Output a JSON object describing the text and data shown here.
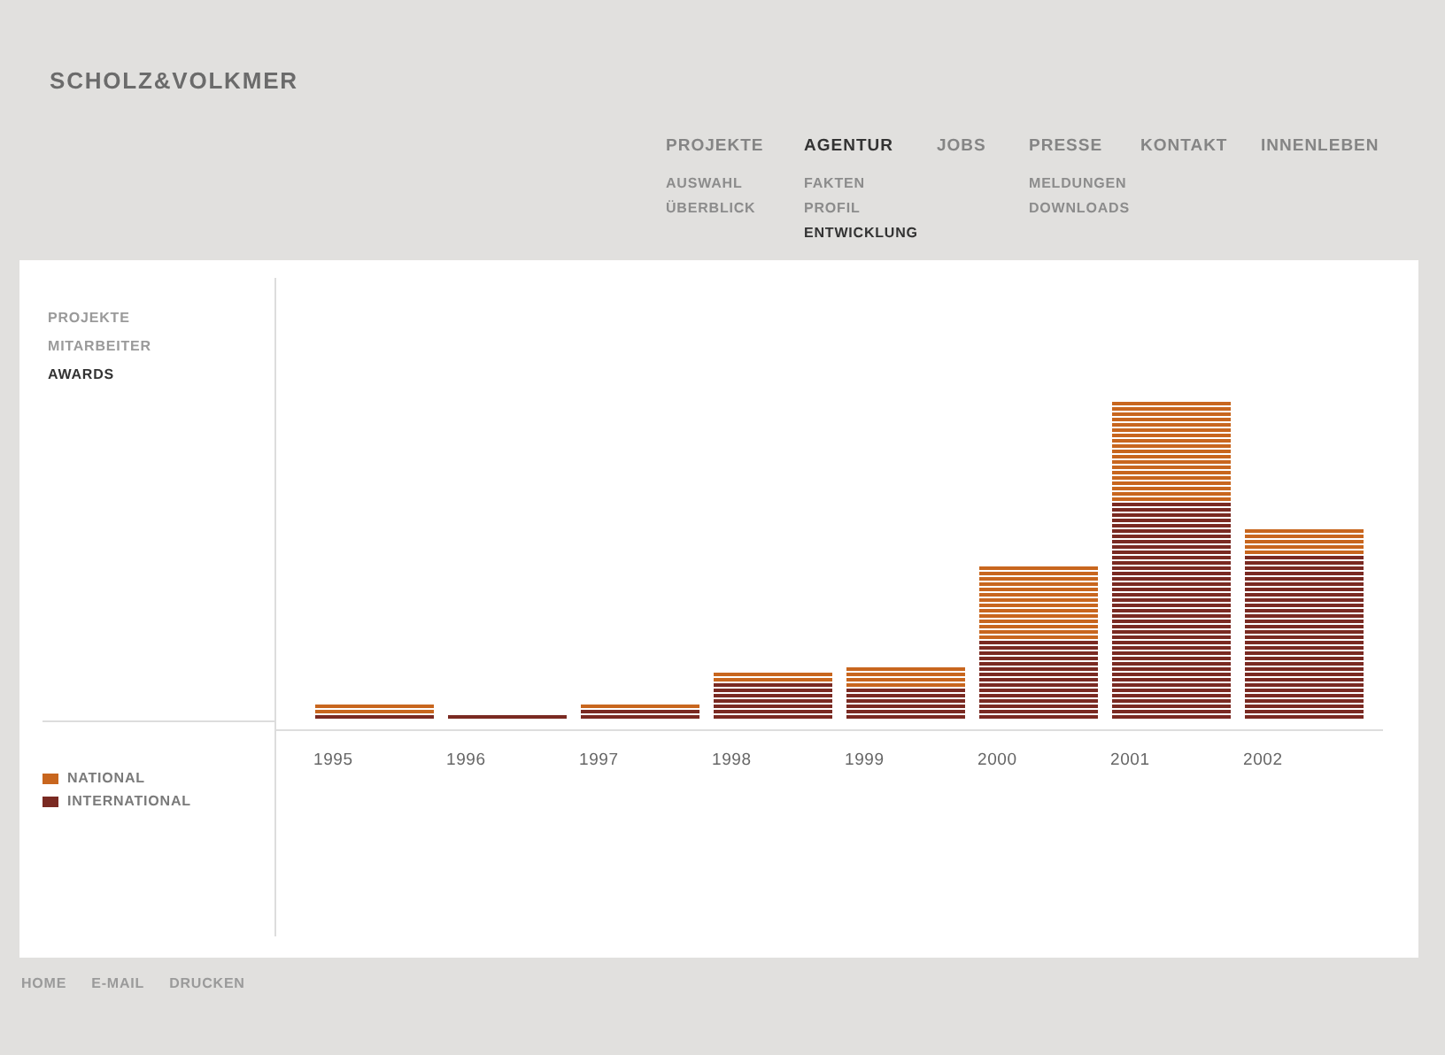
{
  "logo": "SCHOLZ&VOLKMER",
  "nav": [
    {
      "label": "PROJEKTE",
      "selected": false,
      "children": [
        {
          "label": "AUSWAHL",
          "selected": false
        },
        {
          "label": "ÜBERBLICK",
          "selected": false
        }
      ]
    },
    {
      "label": "AGENTUR",
      "selected": true,
      "children": [
        {
          "label": "FAKTEN",
          "selected": false
        },
        {
          "label": "PROFIL",
          "selected": false
        },
        {
          "label": "ENTWICKLUNG",
          "selected": true
        }
      ]
    },
    {
      "label": "JOBS",
      "selected": false
    },
    {
      "label": "PRESSE",
      "selected": false,
      "children": [
        {
          "label": "MELDUNGEN",
          "selected": false
        },
        {
          "label": "DOWNLOADS",
          "selected": false
        }
      ]
    },
    {
      "label": "KONTAKT",
      "selected": false
    },
    {
      "label": "INNENLEBEN",
      "selected": false
    }
  ],
  "side_menu": [
    {
      "label": "PROJEKTE",
      "selected": false
    },
    {
      "label": "MITARBEITER",
      "selected": false
    },
    {
      "label": "AWARDS",
      "selected": true
    }
  ],
  "chart": {
    "years": [
      "1995",
      "1996",
      "1997",
      "1998",
      "1999",
      "2000",
      "2001",
      "2002"
    ],
    "legend": [
      {
        "name": "NATIONAL",
        "color": "#c8661e"
      },
      {
        "name": "INTERNATIONAL",
        "color": "#7a2a22"
      }
    ]
  },
  "footer": [
    "HOME",
    "E-MAIL",
    "DRUCKEN"
  ]
}
